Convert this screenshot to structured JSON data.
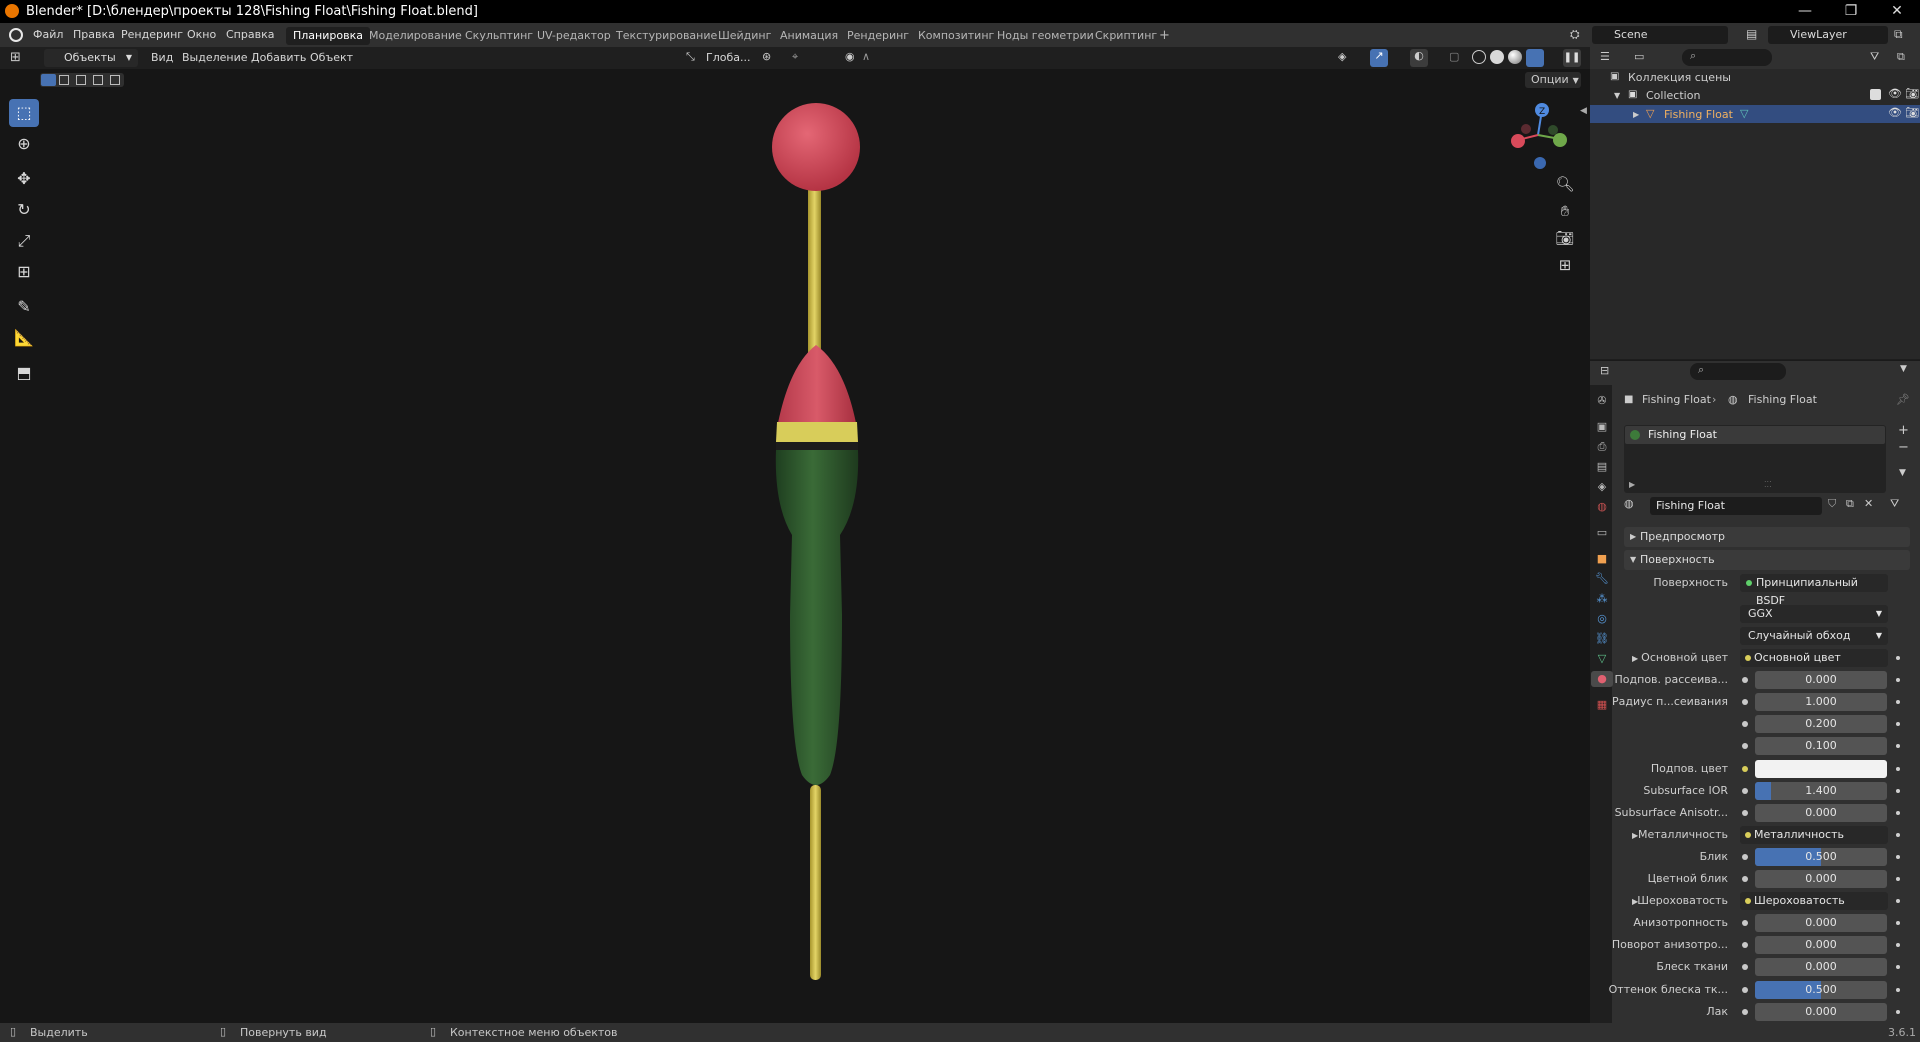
{
  "window": {
    "title": "Blender* [D:\\блендер\\проекты 128\\Fishing Float\\Fishing Float.blend]",
    "minimize": "—",
    "maximize": "❐",
    "close": "✕"
  },
  "menu": [
    "Файл",
    "Правка",
    "Рендеринг",
    "Окно",
    "Справка"
  ],
  "workspaces": [
    "Планировка",
    "Моделирование",
    "Скульптинг",
    "UV-редактор",
    "Текстурирование",
    "Шейдинг",
    "Анимация",
    "Рендеринг",
    "Композитинг",
    "Ноды геометрии",
    "Скриптинг"
  ],
  "workspace_add": "+",
  "scene": {
    "name": "Scene",
    "view_layer": "ViewLayer"
  },
  "viewport_header": {
    "mode": "Объекты",
    "menus": [
      "Вид",
      "Выделение",
      "Добавить",
      "Объект"
    ],
    "orientation": "Глоба...",
    "options": "Опции"
  },
  "outliner": {
    "scene_collection": "Коллекция сцены",
    "collection": "Collection",
    "object": "Fishing Float"
  },
  "properties": {
    "breadcrumb_object": "Fishing Float",
    "breadcrumb_material": "Fishing Float",
    "material_slot": "Fishing Float",
    "material_name": "Fishing Float",
    "panel_preview": "Предпросмотр",
    "panel_surface": "Поверхность",
    "surface_label": "Поверхность",
    "surface_value": "Принципиальный BSDF",
    "distribution": "GGX",
    "subsurface_method": "Случайный обход",
    "rows": [
      {
        "label": "Основной цвет",
        "value": "Основной цвет",
        "kind": "link"
      },
      {
        "label": "Подпов. рассеива...",
        "value": "0.000",
        "kind": "num",
        "fill": 0
      },
      {
        "label": "Радиус п...сеивания",
        "value": "1.000",
        "kind": "num",
        "fill": 0
      },
      {
        "label": "",
        "value": "0.200",
        "kind": "num",
        "fill": 0
      },
      {
        "label": "",
        "value": "0.100",
        "kind": "num",
        "fill": 0
      },
      {
        "label": "Подпов. цвет",
        "value": "",
        "kind": "color",
        "color": "#f2f2f2"
      },
      {
        "label": "Subsurface IOR",
        "value": "1.400",
        "kind": "num",
        "fill": 0.12
      },
      {
        "label": "Subsurface Anisotr...",
        "value": "0.000",
        "kind": "num",
        "fill": 0
      },
      {
        "label": "Металличность",
        "value": "Металличность",
        "kind": "link"
      },
      {
        "label": "Блик",
        "value": "0.500",
        "kind": "num",
        "fill": 0.5
      },
      {
        "label": "Цветной блик",
        "value": "0.000",
        "kind": "num",
        "fill": 0
      },
      {
        "label": "Шероховатость",
        "value": "Шероховатость",
        "kind": "link"
      },
      {
        "label": "Анизотропность",
        "value": "0.000",
        "kind": "num",
        "fill": 0
      },
      {
        "label": "Поворот анизотро...",
        "value": "0.000",
        "kind": "num",
        "fill": 0
      },
      {
        "label": "Блеск ткани",
        "value": "0.000",
        "kind": "num",
        "fill": 0
      },
      {
        "label": "Оттенок блеска тк...",
        "value": "0.500",
        "kind": "num",
        "fill": 0.5
      },
      {
        "label": "Лак",
        "value": "0.000",
        "kind": "num",
        "fill": 0
      }
    ]
  },
  "statusbar": {
    "select": "Выделить",
    "rotate": "Повернуть вид",
    "context": "Контекстное меню объектов",
    "version": "3.6.1"
  },
  "colors": {
    "accent": "#4772b3",
    "float_red": "#d24a5c",
    "float_yellow": "#d8cd5a",
    "float_green": "#2f5a2e",
    "stick": "#cfbf4c"
  }
}
